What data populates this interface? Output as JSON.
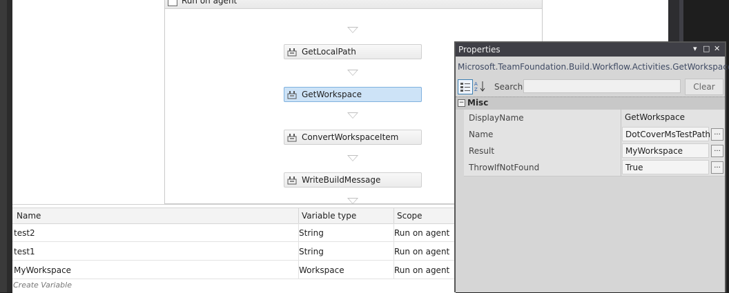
{
  "sequence": {
    "title": "Run on agent"
  },
  "activities": [
    {
      "label": "GetLocalPath",
      "selected": false
    },
    {
      "label": "GetWorkspace",
      "selected": true
    },
    {
      "label": "ConvertWorkspaceItem",
      "selected": false
    },
    {
      "label": "WriteBuildMessage",
      "selected": false
    }
  ],
  "variables": {
    "columns": [
      "Name",
      "Variable type",
      "Scope"
    ],
    "rows": [
      {
        "name": "test2",
        "type": "String",
        "scope": "Run on agent"
      },
      {
        "name": "test1",
        "type": "String",
        "scope": "Run on agent"
      },
      {
        "name": "MyWorkspace",
        "type": "Workspace",
        "scope": "Run on agent"
      }
    ],
    "create_label": "Create Variable"
  },
  "properties": {
    "title": "Properties",
    "type_name": "Microsoft.TeamFoundation.Build.Workflow.Activities.GetWorkspace",
    "search_label": "Search:",
    "search_value": "",
    "clear_label": "Clear",
    "category": "Misc",
    "rows": [
      {
        "name": "DisplayName",
        "value": "GetWorkspace",
        "has_ellipsis": false
      },
      {
        "name": "Name",
        "value": "DotCoverMsTestPath",
        "has_ellipsis": true
      },
      {
        "name": "Result",
        "value": "MyWorkspace",
        "has_ellipsis": true
      },
      {
        "name": "ThrowIfNotFound",
        "value": "True",
        "has_ellipsis": true
      }
    ],
    "ellipsis_label": "..."
  },
  "icons": {
    "activity": "activity-icon",
    "sort_category": "category-sort-icon",
    "sort_alpha": "alpha-sort-icon"
  },
  "colors": {
    "selected_activity": "#cde3f7",
    "titlebar": "#3f3f46"
  }
}
